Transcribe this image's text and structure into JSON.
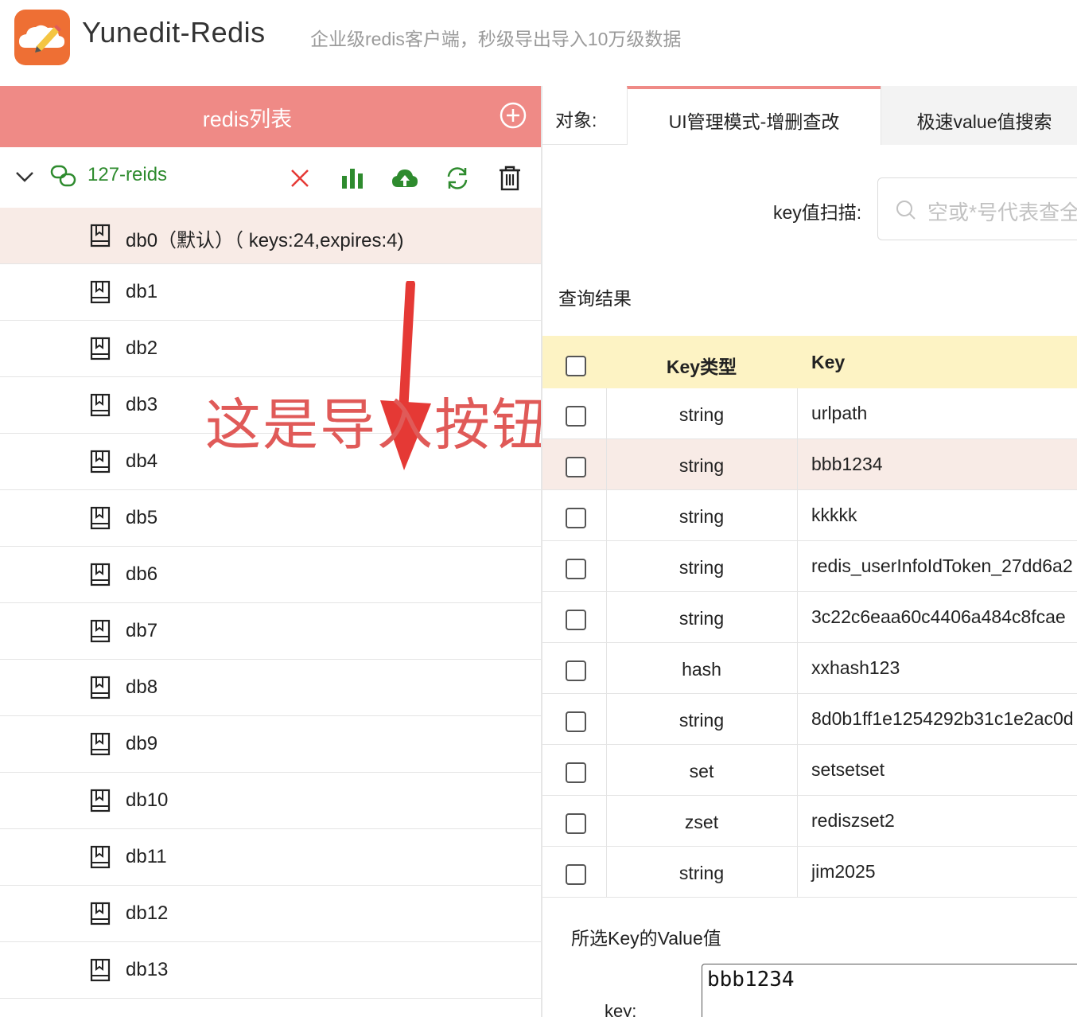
{
  "header": {
    "title": "Yunedit-Redis",
    "subtitle": "企业级redis客户端，秒级导出导入10万级数据",
    "accent": "#ee6f34"
  },
  "sidebar": {
    "title": "redis列表",
    "header_color": "#ef8a86",
    "connection": {
      "name": "127-reids",
      "toolbar_icons": [
        "close-icon",
        "bar-chart-icon",
        "cloud-upload-icon",
        "refresh-icon",
        "trash-icon"
      ]
    },
    "dbs": [
      {
        "label": "db0（默认）（ keys:24,expires:4)"
      },
      {
        "label": "db1"
      },
      {
        "label": "db2"
      },
      {
        "label": "db3"
      },
      {
        "label": "db4"
      },
      {
        "label": "db5"
      },
      {
        "label": "db6"
      },
      {
        "label": "db7"
      },
      {
        "label": "db8"
      },
      {
        "label": "db9"
      },
      {
        "label": "db10"
      },
      {
        "label": "db11"
      },
      {
        "label": "db12"
      },
      {
        "label": "db13"
      }
    ]
  },
  "annotation": {
    "text": "这是导入按钮",
    "color": "#e53935"
  },
  "main": {
    "tabs_lead": "对象:",
    "tabs": [
      {
        "label": "UI管理模式-增删查改"
      },
      {
        "label": "极速value值搜索"
      }
    ],
    "scan": {
      "label": "key值扫描:",
      "placeholder": "空或*号代表查全部"
    },
    "result_title": "查询结果",
    "table": {
      "columns": [
        "Key类型",
        "Key"
      ],
      "rows": [
        {
          "type": "string",
          "key": "urlpath"
        },
        {
          "type": "string",
          "key": "bbb1234"
        },
        {
          "type": "string",
          "key": "kkkkk"
        },
        {
          "type": "string",
          "key": "redis_userInfoIdToken_27dd6a2"
        },
        {
          "type": "string",
          "key": "3c22c6eaa60c4406a484c8fcae"
        },
        {
          "type": "hash",
          "key": "xxhash123"
        },
        {
          "type": "string",
          "key": "8d0b1ff1e1254292b31c1e2ac0d"
        },
        {
          "type": "set",
          "key": "setsetset"
        },
        {
          "type": "zset",
          "key": "rediszset2"
        },
        {
          "type": "string",
          "key": "jim2025"
        }
      ]
    },
    "value": {
      "title": "所选Key的Value值",
      "key_label": "key:",
      "key_value": "bbb1234"
    }
  }
}
